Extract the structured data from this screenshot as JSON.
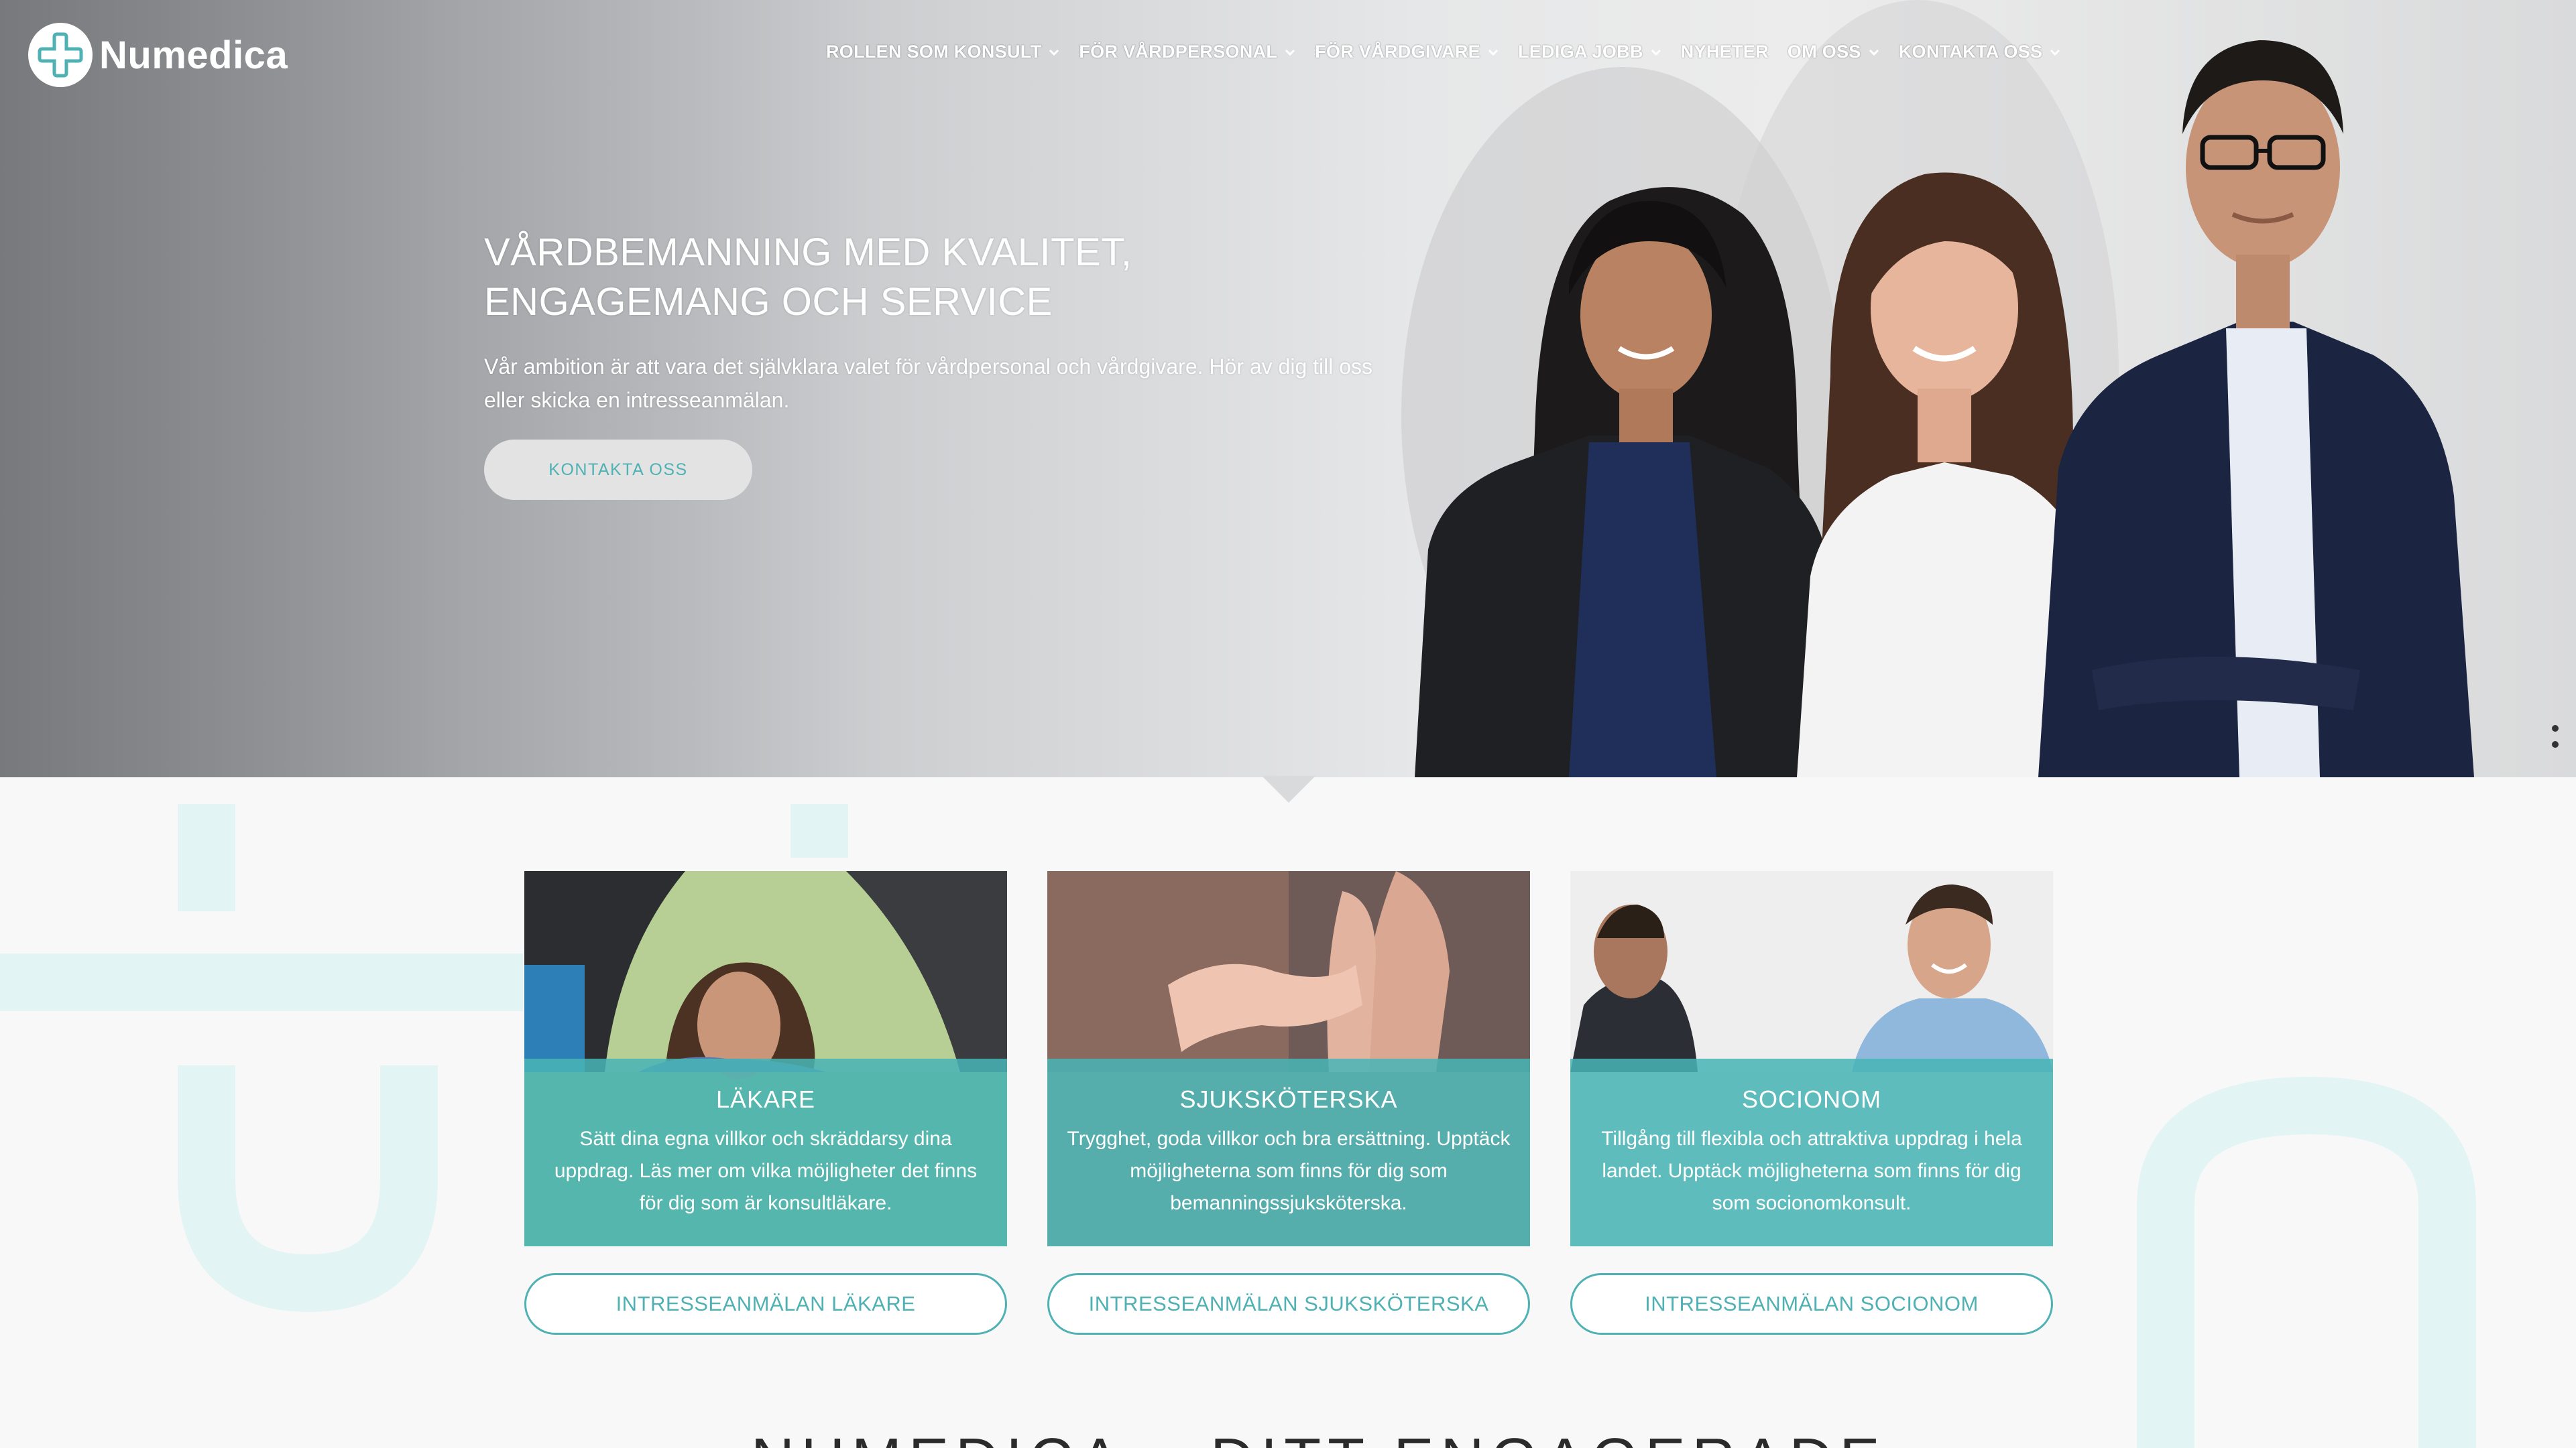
{
  "brand": {
    "name": "Numedica",
    "accent": "#4fb1b3",
    "logo_icon": "medical-cross-icon"
  },
  "nav": {
    "items": [
      {
        "label": "ROLLEN SOM KONSULT",
        "icon": "chevron-down-icon"
      },
      {
        "label": "FÖR VÅRDPERSONAL",
        "icon": "chevron-down-icon"
      },
      {
        "label": "FÖR VÅRDGIVARE",
        "icon": "chevron-down-icon"
      },
      {
        "label": "LEDIGA JOBB",
        "icon": "chevron-down-icon"
      },
      {
        "label": "NYHETER",
        "icon": ""
      },
      {
        "label": "OM OSS",
        "icon": "chevron-down-icon"
      },
      {
        "label": "KONTAKTA OSS",
        "icon": "chevron-down-icon"
      }
    ]
  },
  "hero": {
    "title": "VÅRDBEMANNING MED KVALITET, ENGAGEMANG OCH SERVICE",
    "subtitle": "Vår ambition är att vara det självklara valet för vårdpersonal och vårdgivare. Hör av dig till oss eller skicka en intresseanmälan.",
    "cta": "KONTAKTA OSS"
  },
  "cards": [
    {
      "title": "LÄKARE",
      "text": "Sätt dina egna villkor och skräddarsy dina uppdrag. Läs mer om vilka möjligheter det finns för dig som är konsultläkare.",
      "button": "INTRESSEANMÄLAN LÄKARE"
    },
    {
      "title": "SJUKSKÖTERSKA",
      "text": "Trygghet, goda villkor och bra ersättning. Upptäck möjligheterna som finns för dig som bemanningssjuksköterska.",
      "button": "INTRESSEANMÄLAN SJUKSKÖTERSKA"
    },
    {
      "title": "SOCIONOM",
      "text": "Tillgång till flexibla och attraktiva uppdrag i hela landet. Upptäck möjligheterna som finns för dig som socionomkonsult.",
      "button": "INTRESSEANMÄLAN SOCIONOM"
    }
  ],
  "section": {
    "heading": "NUMEDICA – DITT ENGAGERADE"
  }
}
